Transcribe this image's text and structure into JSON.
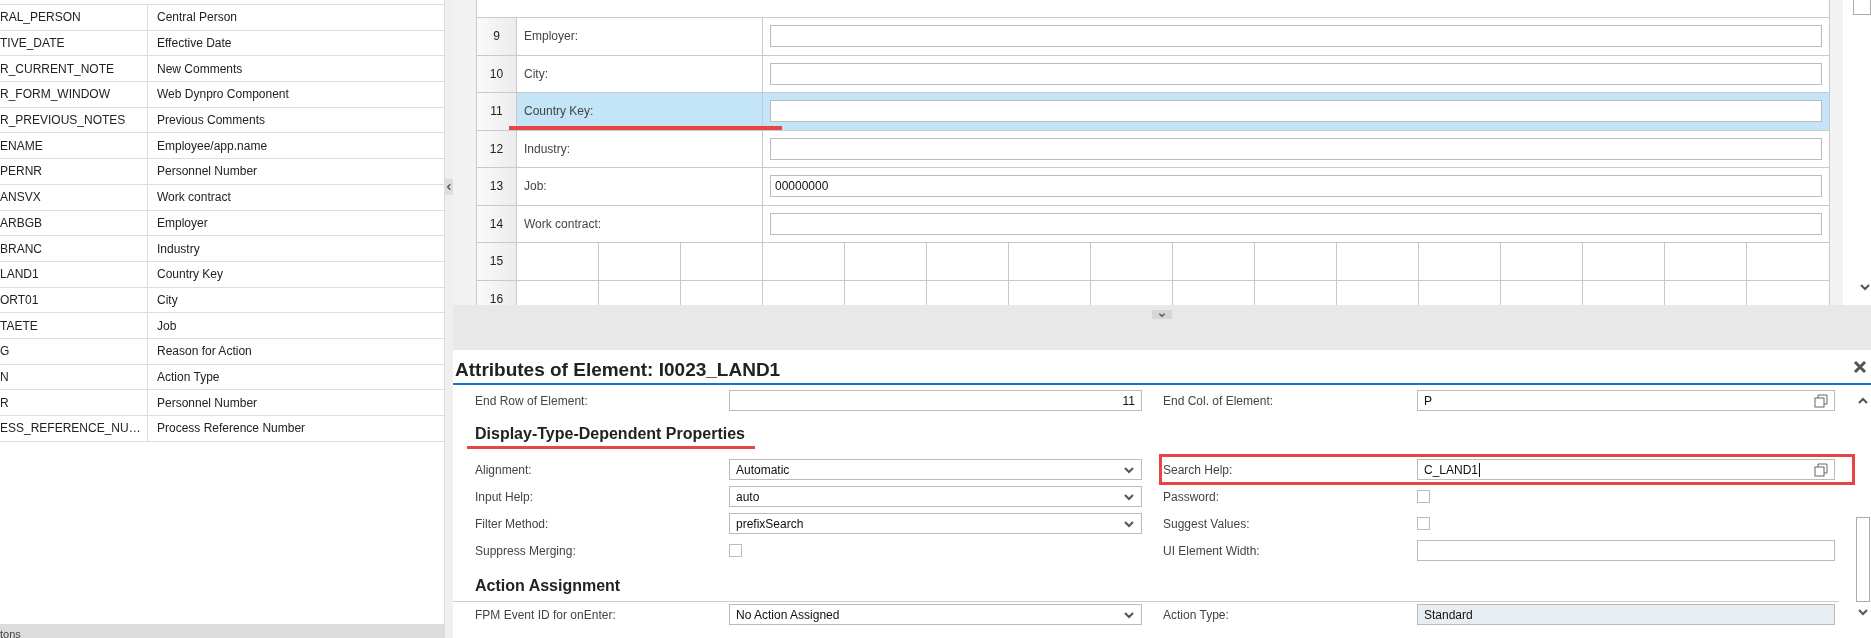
{
  "mapping_table": {
    "rows": [
      {
        "field": "RAL_PERSON",
        "description": "Central Person"
      },
      {
        "field": "TIVE_DATE",
        "description": "Effective Date"
      },
      {
        "field": "R_CURRENT_NOTE",
        "description": "New Comments"
      },
      {
        "field": "R_FORM_WINDOW",
        "description": "Web Dynpro Component"
      },
      {
        "field": "R_PREVIOUS_NOTES",
        "description": "Previous Comments"
      },
      {
        "field": "ENAME",
        "description": "Employee/app.name"
      },
      {
        "field": "PERNR",
        "description": "Personnel Number"
      },
      {
        "field": "ANSVX",
        "description": "Work contract"
      },
      {
        "field": "ARBGB",
        "description": "Employer"
      },
      {
        "field": "BRANC",
        "description": "Industry"
      },
      {
        "field": "LAND1",
        "description": "Country Key"
      },
      {
        "field": "ORT01",
        "description": "City"
      },
      {
        "field": "TAETE",
        "description": "Job"
      },
      {
        "field": "G",
        "description": "Reason for Action"
      },
      {
        "field": "N",
        "description": "Action Type"
      },
      {
        "field": "R",
        "description": "Personnel Number"
      },
      {
        "field": "ESS_REFERENCE_NU…",
        "description": "Process Reference Number"
      }
    ],
    "footer": "tons"
  },
  "layout_grid": {
    "rows": [
      {
        "number": "9",
        "kind": "field",
        "label": "Employer:",
        "selected": false,
        "annotated": false
      },
      {
        "number": "10",
        "kind": "field",
        "label": "City:",
        "selected": false,
        "annotated": false
      },
      {
        "number": "11",
        "kind": "field",
        "label": "Country Key:",
        "selected": true,
        "annotated": true
      },
      {
        "number": "12",
        "kind": "field",
        "label": "Industry:",
        "selected": false,
        "annotated": false
      },
      {
        "number": "13",
        "kind": "field",
        "label": "Job:",
        "value": "00000000",
        "selected": false,
        "annotated": false
      },
      {
        "number": "14",
        "kind": "field",
        "label": "Work contract:",
        "selected": false,
        "annotated": false
      },
      {
        "number": "15",
        "kind": "empty",
        "selected": false
      },
      {
        "number": "16",
        "kind": "empty",
        "selected": false
      }
    ]
  },
  "attributes_panel": {
    "title": "Attributes of Element: I0023_LAND1",
    "sections": [
      {
        "rows": [
          [
            {
              "label": "End Row of Element:",
              "kind": "number",
              "value": "11"
            },
            {
              "label": "End Col. of Element:",
              "kind": "valuehelp",
              "value": "P"
            }
          ]
        ]
      },
      {
        "title": "Display-Type-Dependent Properties",
        "annotated": true,
        "rows": [
          [
            {
              "label": "Alignment:",
              "kind": "select",
              "value": "Automatic"
            },
            {
              "label": "Search Help:",
              "kind": "valuehelp",
              "value": "C_LAND1",
              "annotated": true,
              "focused": true
            }
          ],
          [
            {
              "label": "Input Help:",
              "kind": "select",
              "value": "auto"
            },
            {
              "label": "Password:",
              "kind": "checkbox",
              "checked": false
            }
          ],
          [
            {
              "label": "Filter Method:",
              "kind": "select",
              "value": "prefixSearch"
            },
            {
              "label": "Suggest Values:",
              "kind": "checkbox",
              "checked": false
            }
          ],
          [
            {
              "label": "Suppress Merging:",
              "kind": "checkbox",
              "checked": false
            },
            {
              "label": "UI Element Width:",
              "kind": "text"
            }
          ]
        ]
      },
      {
        "title": "Action Assignment",
        "annotated": false,
        "divider": true,
        "rows": [
          [
            {
              "label": "FPM Event ID for onEnter:",
              "kind": "select",
              "value": "No Action Assigned"
            },
            {
              "label": "Action Type:",
              "kind": "readonly",
              "value": "Standard"
            }
          ]
        ]
      }
    ]
  }
}
